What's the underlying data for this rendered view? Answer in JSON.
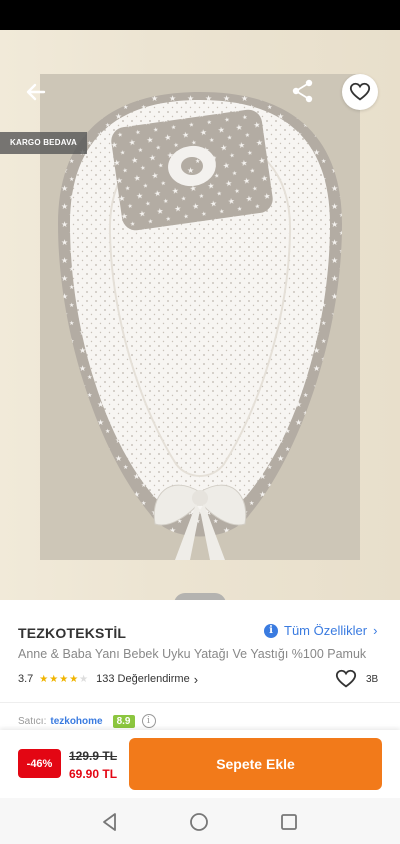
{
  "gallery": {
    "badge": "KARGO BEDAVA",
    "icons": {
      "back": "arrow-left-icon",
      "share": "share-icon",
      "favorite": "heart-outline-icon"
    },
    "pager": {
      "pages": 1,
      "current": 1
    }
  },
  "product": {
    "seller": "TEZKOTEKSTİL",
    "all_features_label": "Tüm Özellikler",
    "name": "Anne & Baba Yanı Bebek Uyku Yatağı Ve Yastığı %100 Pamuk",
    "rating": "3.7",
    "rating_stars": 3.7,
    "reviews": "133 Değerlendirme",
    "likes": "3B"
  },
  "seller_info": {
    "label": "Satıcı:",
    "name": "tezkohome",
    "score": "8.9"
  },
  "purchase": {
    "discount": "-46%",
    "old_price": "129.9 TL",
    "new_price": "69.90 TL",
    "add_to_cart": "Sepete Ekle"
  },
  "colors": {
    "accent": "#f27a1a",
    "discount": "#e30613",
    "link": "#3a7be0",
    "score": "#8cc63f",
    "star": "#f0b400"
  }
}
